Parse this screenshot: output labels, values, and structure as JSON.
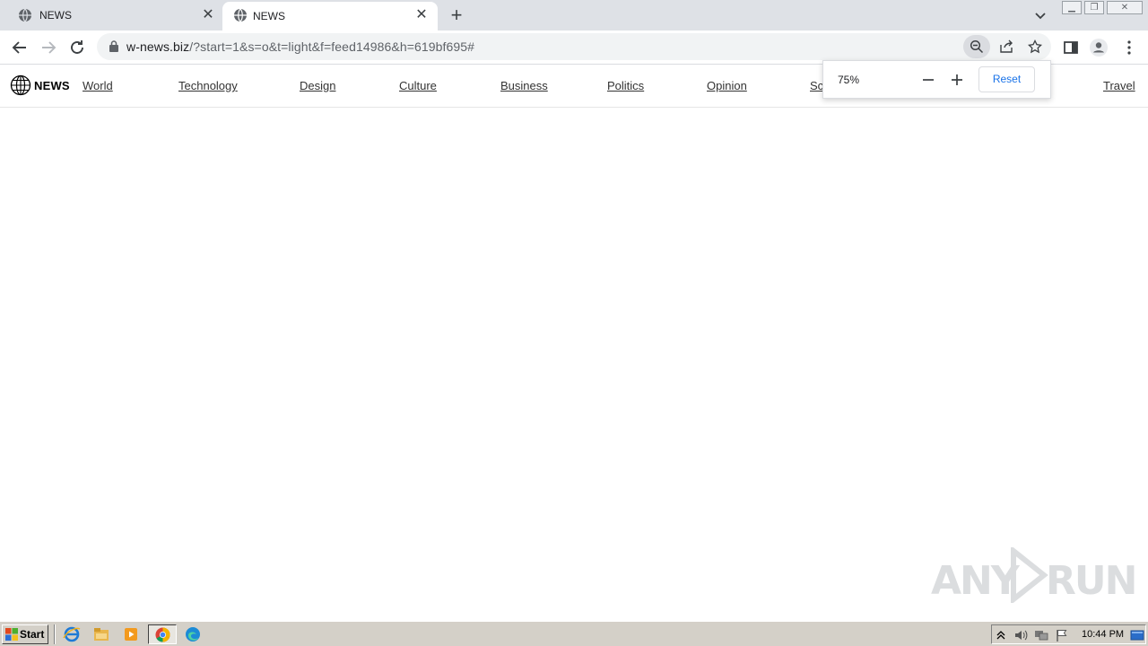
{
  "browser": {
    "tabs": [
      {
        "title": "NEWS",
        "active": false
      },
      {
        "title": "NEWS",
        "active": true
      }
    ],
    "url": {
      "host": "w-news.biz",
      "path": "/?start=1&s=o&t=light&f=feed14986&h=619bf695#"
    },
    "zoom": {
      "level": "75%",
      "reset_label": "Reset"
    }
  },
  "site": {
    "logo": "NEWS",
    "nav": [
      "World",
      "Technology",
      "Design",
      "Culture",
      "Business",
      "Politics",
      "Opinion",
      "Sc",
      "Travel"
    ]
  },
  "watermark": {
    "left": "ANY",
    "right": "RUN"
  },
  "taskbar": {
    "start_label": "Start",
    "clock": "10:44 PM"
  },
  "colors": {
    "tabstrip": "#dee1e6",
    "omnibox": "#f1f3f4",
    "accent": "#1a73e8",
    "taskbar": "#d4d0c8"
  }
}
